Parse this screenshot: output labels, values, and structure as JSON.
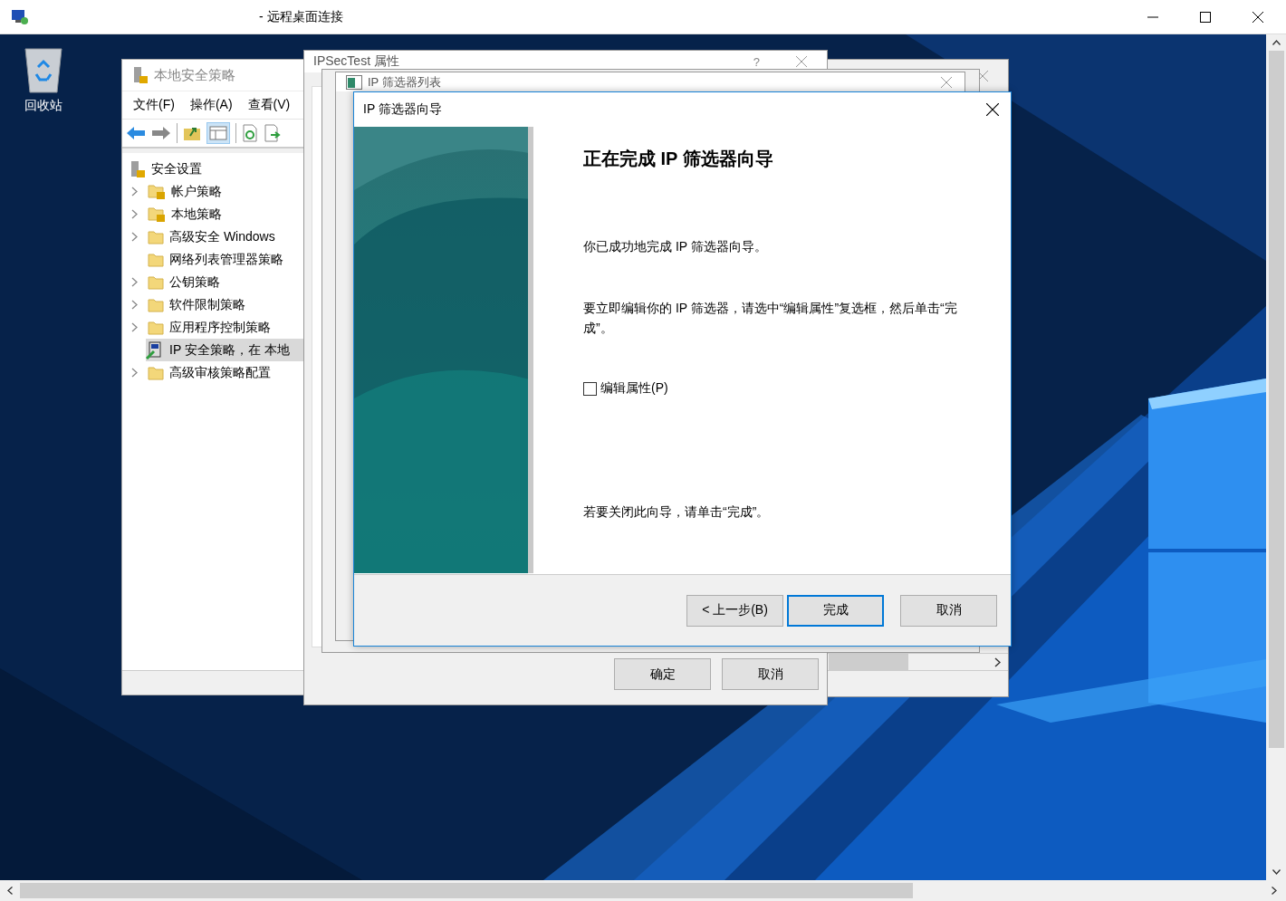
{
  "remote_window": {
    "title": "- 远程桌面连接"
  },
  "desktop": {
    "icons": [
      {
        "label": "回收站"
      }
    ]
  },
  "mmc": {
    "title": "本地安全策略",
    "menu": [
      "文件(F)",
      "操作(A)",
      "查看(V)"
    ],
    "tree": {
      "label": "安全设置",
      "children": [
        {
          "label": "帐户策略",
          "kind": "locked-folder",
          "expandable": true,
          "selected": false
        },
        {
          "label": "本地策略",
          "kind": "locked-folder",
          "expandable": true,
          "selected": false
        },
        {
          "label": "高级安全 Windows",
          "kind": "folder",
          "expandable": true,
          "selected": false
        },
        {
          "label": "网络列表管理器策略",
          "kind": "folder",
          "expandable": false,
          "selected": false
        },
        {
          "label": "公钥策略",
          "kind": "folder",
          "expandable": true,
          "selected": false
        },
        {
          "label": "软件限制策略",
          "kind": "folder",
          "expandable": true,
          "selected": false
        },
        {
          "label": "应用程序控制策略",
          "kind": "folder",
          "expandable": true,
          "selected": false
        },
        {
          "label": "IP 安全策略，在 本地",
          "kind": "ip-policy",
          "expandable": false,
          "selected": true
        },
        {
          "label": "高级审核策略配置",
          "kind": "folder",
          "expandable": true,
          "selected": false
        }
      ]
    }
  },
  "ipsec_dialog": {
    "title": "IPSecTest 属性",
    "help": "?",
    "buttons": [
      "确定",
      "取消"
    ]
  },
  "filter_list": {
    "title": "IP 筛选器列表"
  },
  "wizard": {
    "title": "IP 筛选器向导",
    "heading": "正在完成 IP 筛选器向导",
    "paragraphs": [
      "你已成功地完成 IP 筛选器向导。",
      "要立即编辑你的 IP 筛选器，请选中“编辑属性”复选框，然后单击“完成”。"
    ],
    "checkbox": {
      "label": "编辑属性(P)",
      "checked": false
    },
    "closing": "若要关闭此向导，请单击“完成”。",
    "buttons": [
      {
        "label": "< 上一步(B)",
        "default": false
      },
      {
        "label": "完成",
        "default": true
      },
      {
        "label": "取消",
        "default": false
      }
    ]
  }
}
